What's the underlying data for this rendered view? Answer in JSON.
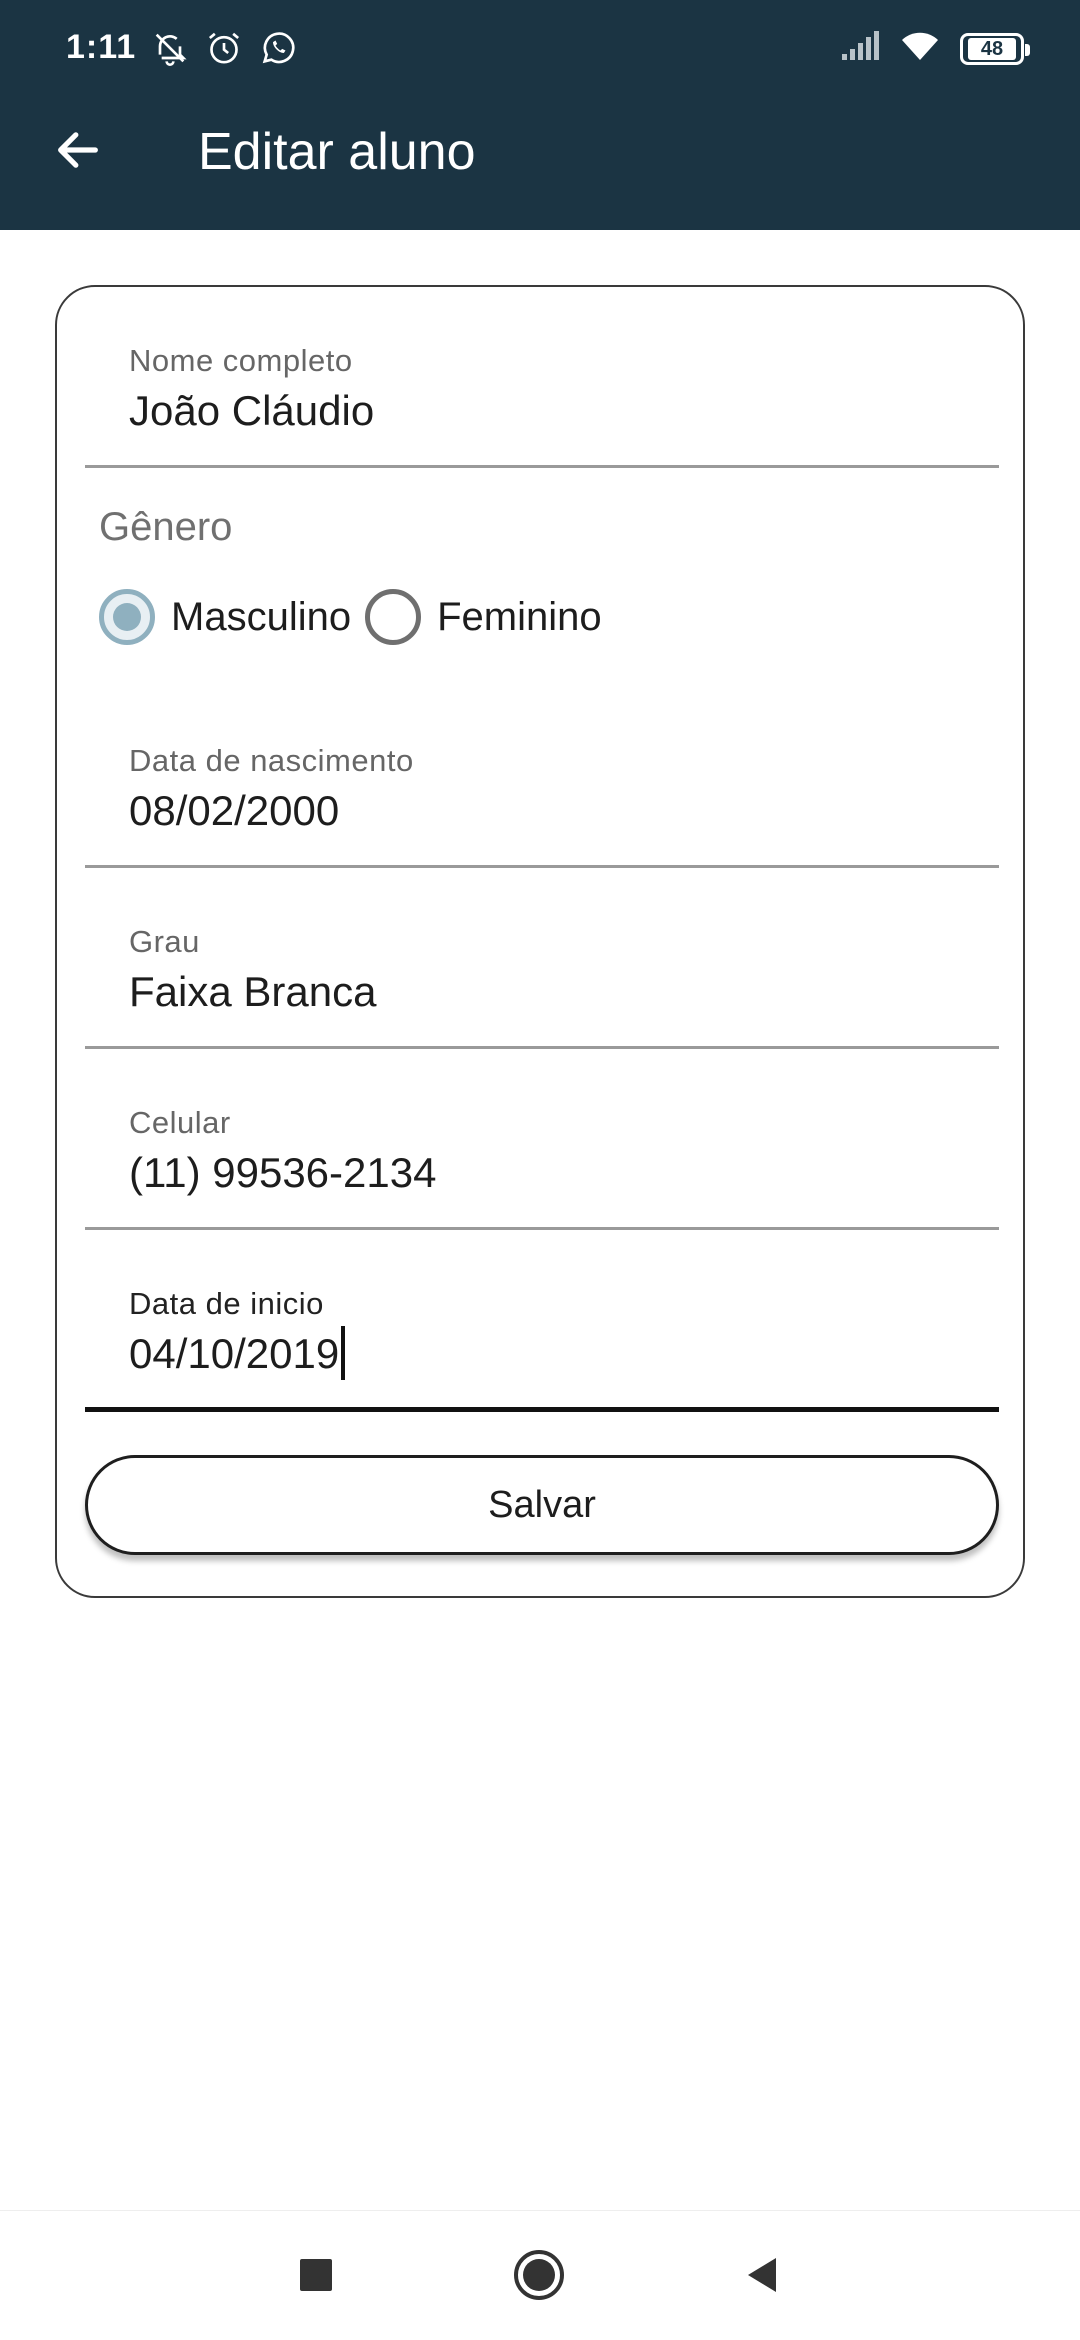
{
  "status_bar": {
    "time": "1:11",
    "battery": "48",
    "icons": [
      "bell-muted-icon",
      "alarm-icon",
      "whatsapp-icon",
      "signal-icon",
      "wifi-icon",
      "battery-icon"
    ]
  },
  "header": {
    "title": "Editar aluno",
    "back_icon": "arrow-left-icon",
    "background": "#1b3443"
  },
  "form": {
    "full_name": {
      "label": "Nome completo",
      "value": "João Cláudio"
    },
    "gender": {
      "label": "Gênero",
      "options": [
        {
          "label": "Masculino",
          "selected": true
        },
        {
          "label": "Feminino",
          "selected": false
        }
      ]
    },
    "birth_date": {
      "label": "Data de nascimento",
      "value": "08/02/2000"
    },
    "rank": {
      "label": "Grau",
      "value": "Faixa Branca"
    },
    "phone": {
      "label": "Celular",
      "value": "(11) 99536-2134"
    },
    "start_date": {
      "label": "Data de inicio",
      "value": "04/10/2019"
    },
    "save_label": "Salvar"
  },
  "nav_bar": {
    "buttons": [
      "recents-square-icon",
      "home-circle-icon",
      "back-triangle-icon"
    ]
  }
}
